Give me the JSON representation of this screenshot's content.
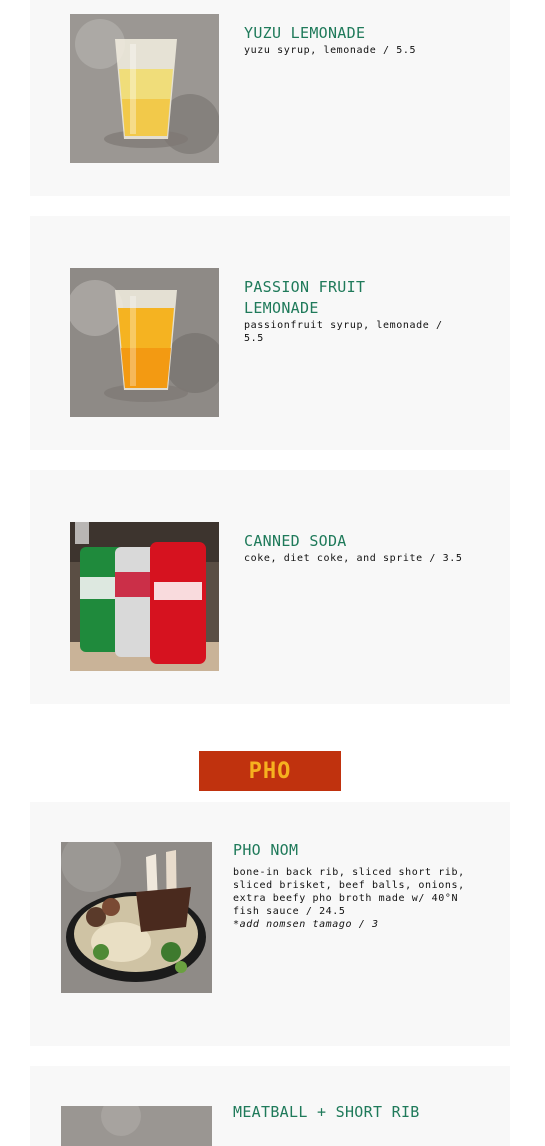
{
  "menu": {
    "items": [
      {
        "title": "YUZU LEMONADE",
        "description": "yuzu syrup, lemonade / 5.5",
        "photo_icon": "yuzu-lemonade-photo"
      },
      {
        "title": "PASSION FRUIT LEMONADE",
        "description": "passionfruit syrup, lemonade / 5.5",
        "photo_icon": "passion-fruit-lemonade-photo"
      },
      {
        "title": "CANNED SODA",
        "description": "coke, diet coke, and sprite / 3.5",
        "photo_icon": "canned-soda-photo"
      }
    ],
    "section": {
      "label": "PHO"
    },
    "pho_items": [
      {
        "title": "PHO NOM",
        "description": "bone-in back rib, sliced short rib, sliced brisket, beef balls, onions, extra beefy pho broth made w/ 40°N fish sauce / 24.5",
        "note": "*add nomsen tamago / 3",
        "photo_icon": "pho-nom-photo"
      },
      {
        "title": "MEATBALL + SHORT RIB",
        "photo_icon": "meatball-short-rib-photo"
      }
    ],
    "colors": {
      "title": "#1f7a5a",
      "banner_bg": "#c0320e",
      "banner_text": "#f6b11f",
      "card_bg": "#f8f8f8"
    }
  }
}
